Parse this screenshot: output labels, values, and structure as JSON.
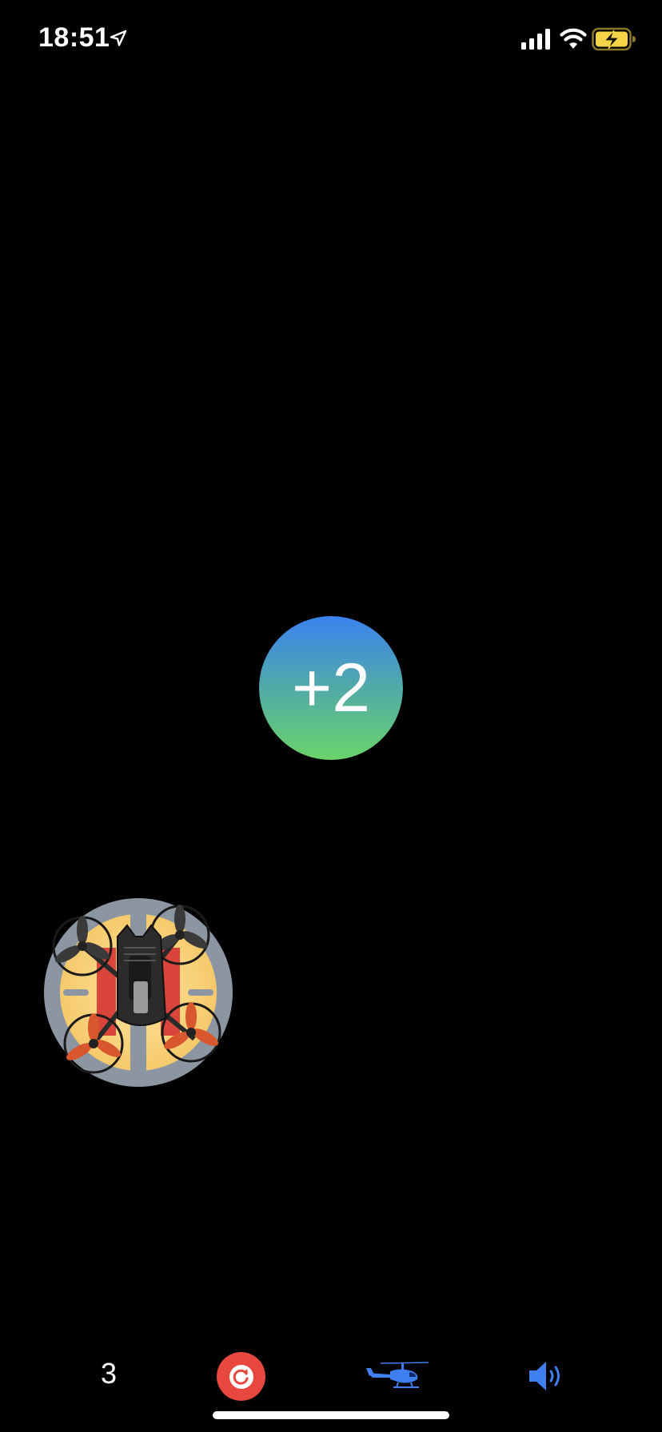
{
  "status_bar": {
    "time": "18:51",
    "icons": [
      "location-arrow-icon",
      "cellular-signal-icon",
      "wifi-icon",
      "battery-charging-icon"
    ],
    "battery_color": "#f5d547"
  },
  "game": {
    "score_bubble_text": "+2",
    "score_bubble_colors": [
      "#3b82f0",
      "#6bd36a"
    ],
    "player_sprite": "quadcopter-drone"
  },
  "bottom_bar": {
    "lives": "3",
    "restart_icon": "restart-icon",
    "restart_color": "#e8473f",
    "helicopter_icon": "helicopter-icon",
    "sound_icon": "speaker-icon",
    "accent_color": "#3f7ff0"
  }
}
